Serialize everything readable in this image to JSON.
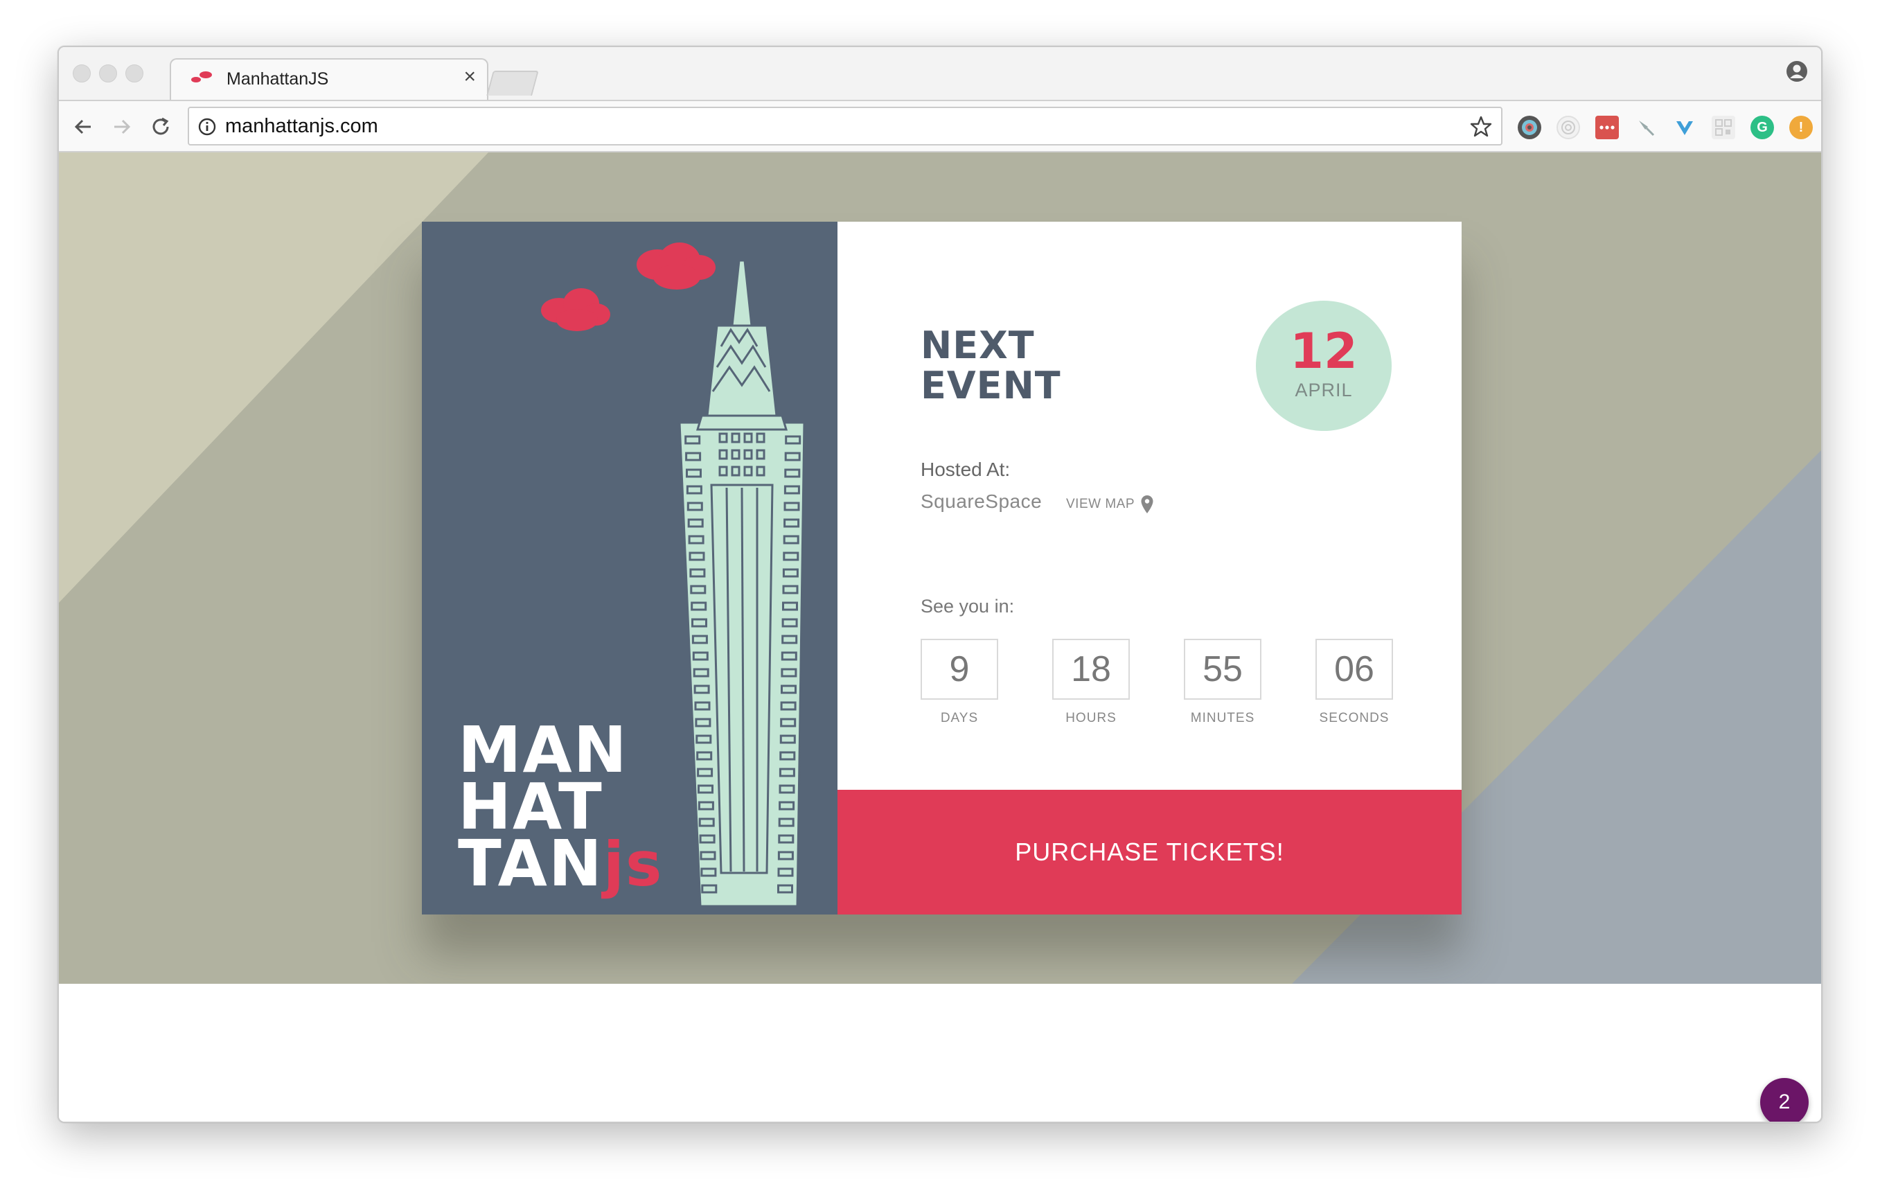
{
  "browser": {
    "tab_title": "ManhattanJS",
    "tab_close": "×",
    "url": "manhattanjs.com",
    "extensions": [
      "color-wheel-extension-icon",
      "target-extension-icon",
      "lastpass-icon",
      "pin-extension-icon",
      "vue-devtools-icon",
      "qr-extension-icon",
      "grammarly-icon",
      "warning-extension-icon"
    ]
  },
  "event": {
    "heading_line1": "NEXT",
    "heading_line2": "EVENT",
    "day": "12",
    "month": "APRIL",
    "hosted_label": "Hosted At:",
    "venue": "SquareSpace",
    "view_map": "VIEW MAP",
    "see_you": "See you in:"
  },
  "countdown": {
    "days": "9",
    "hours": "18",
    "minutes": "55",
    "seconds": "06",
    "days_label": "DAYS",
    "hours_label": "HOURS",
    "minutes_label": "MINUTES",
    "seconds_label": "SECONDS"
  },
  "wordmark": {
    "line1": "MAN",
    "line2": "HAT",
    "line3": "TAN",
    "suffix": "js"
  },
  "cta": {
    "purchase_label": "PURCHASE TICKETS!"
  },
  "notification": {
    "count": "2"
  },
  "colors": {
    "accent": "#e03b57",
    "slate": "#566577",
    "mint": "#c4e6d5",
    "badge": "#6b1567"
  }
}
